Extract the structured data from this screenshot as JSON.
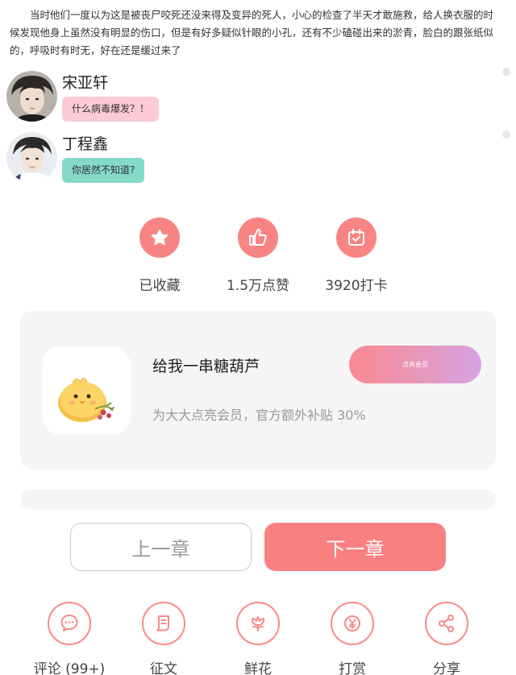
{
  "story": {
    "paragraph": "当时他们一度以为这是被丧尸咬死还没来得及变异的死人，小心的检查了半天才敢施救，给人换衣服的时候发现他身上虽然没有明显的伤口，但是有好多疑似针眼的小孔，还有不少磕碰出来的淤青，脸白的跟张纸似的，呼吸时有时无，好在还是缓过来了"
  },
  "messages": [
    {
      "name": "宋亚轩",
      "text": "什么病毒爆发？！",
      "bubble_color": "#fccbd6"
    },
    {
      "name": "丁程鑫",
      "text": "你居然不知道?",
      "bubble_color": "#84d9c9"
    }
  ],
  "stats": [
    {
      "icon": "star-icon",
      "label": "已收藏"
    },
    {
      "icon": "thumbs-up-icon",
      "label": "1.5万点赞"
    },
    {
      "icon": "calendar-check-icon",
      "label": "3920打卡"
    }
  ],
  "member": {
    "title": "给我一串糖葫芦",
    "description": "为大大点亮会员，官方额外补贴 30%",
    "button_label": "点亮会员"
  },
  "navigation": {
    "prev_label": "上一章",
    "next_label": "下一章"
  },
  "actions": [
    {
      "icon": "comment-icon",
      "label": "评论 (99+)"
    },
    {
      "icon": "essay-icon",
      "label": "征文"
    },
    {
      "icon": "flower-icon",
      "label": "鲜花"
    },
    {
      "icon": "yen-icon",
      "label": "打赏"
    },
    {
      "icon": "share-icon",
      "label": "分享"
    }
  ],
  "colors": {
    "accent": "#f98080",
    "card_background": "#f5f5f5",
    "member_gradient": [
      "#f98a8f",
      "#d7a2e2"
    ]
  }
}
